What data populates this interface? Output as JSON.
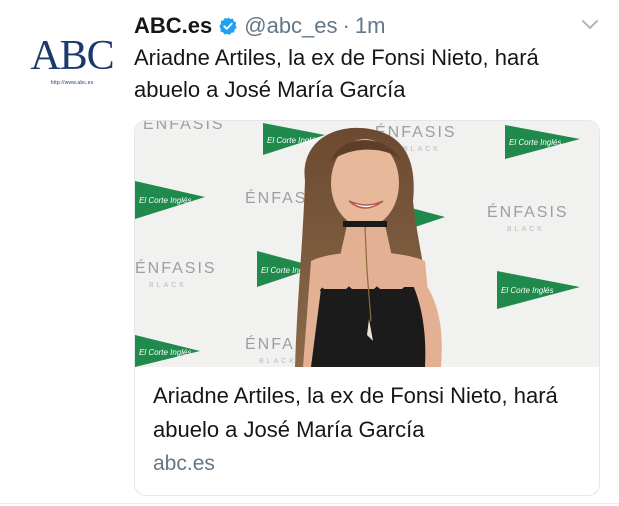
{
  "account": {
    "avatar_text": "ABC",
    "avatar_tagline": "http://www.abc.es",
    "display_name": "ABC.es",
    "verified": true,
    "handle": "@abc_es",
    "separator": "·",
    "timestamp": "1m"
  },
  "tweet": {
    "text": "Ariadne Artiles, la ex de Fonsi Nieto, hará abuelo a José María García"
  },
  "card": {
    "image_description": "photo",
    "backdrop_labels": [
      "ÉNFASIS",
      "ÉNFASIS",
      "ÉNFASIS",
      "ÉNFASIS",
      "ÉNFASIS",
      "ÉNFASIS"
    ],
    "backdrop_sublabel": "BLACK",
    "backdrop_logo": "El Corte Inglés",
    "title": "Ariadne Artiles, la ex de Fonsi Nieto, hará abuelo a José María García",
    "domain": "abc.es"
  },
  "colors": {
    "brand_navy": "#1b3a6b",
    "verified_blue": "#1da1f2",
    "muted_text": "#657786",
    "logo_green": "#1f8a4c"
  },
  "icons": {
    "verified": "verified-badge-icon",
    "caret": "chevron-down-icon"
  }
}
